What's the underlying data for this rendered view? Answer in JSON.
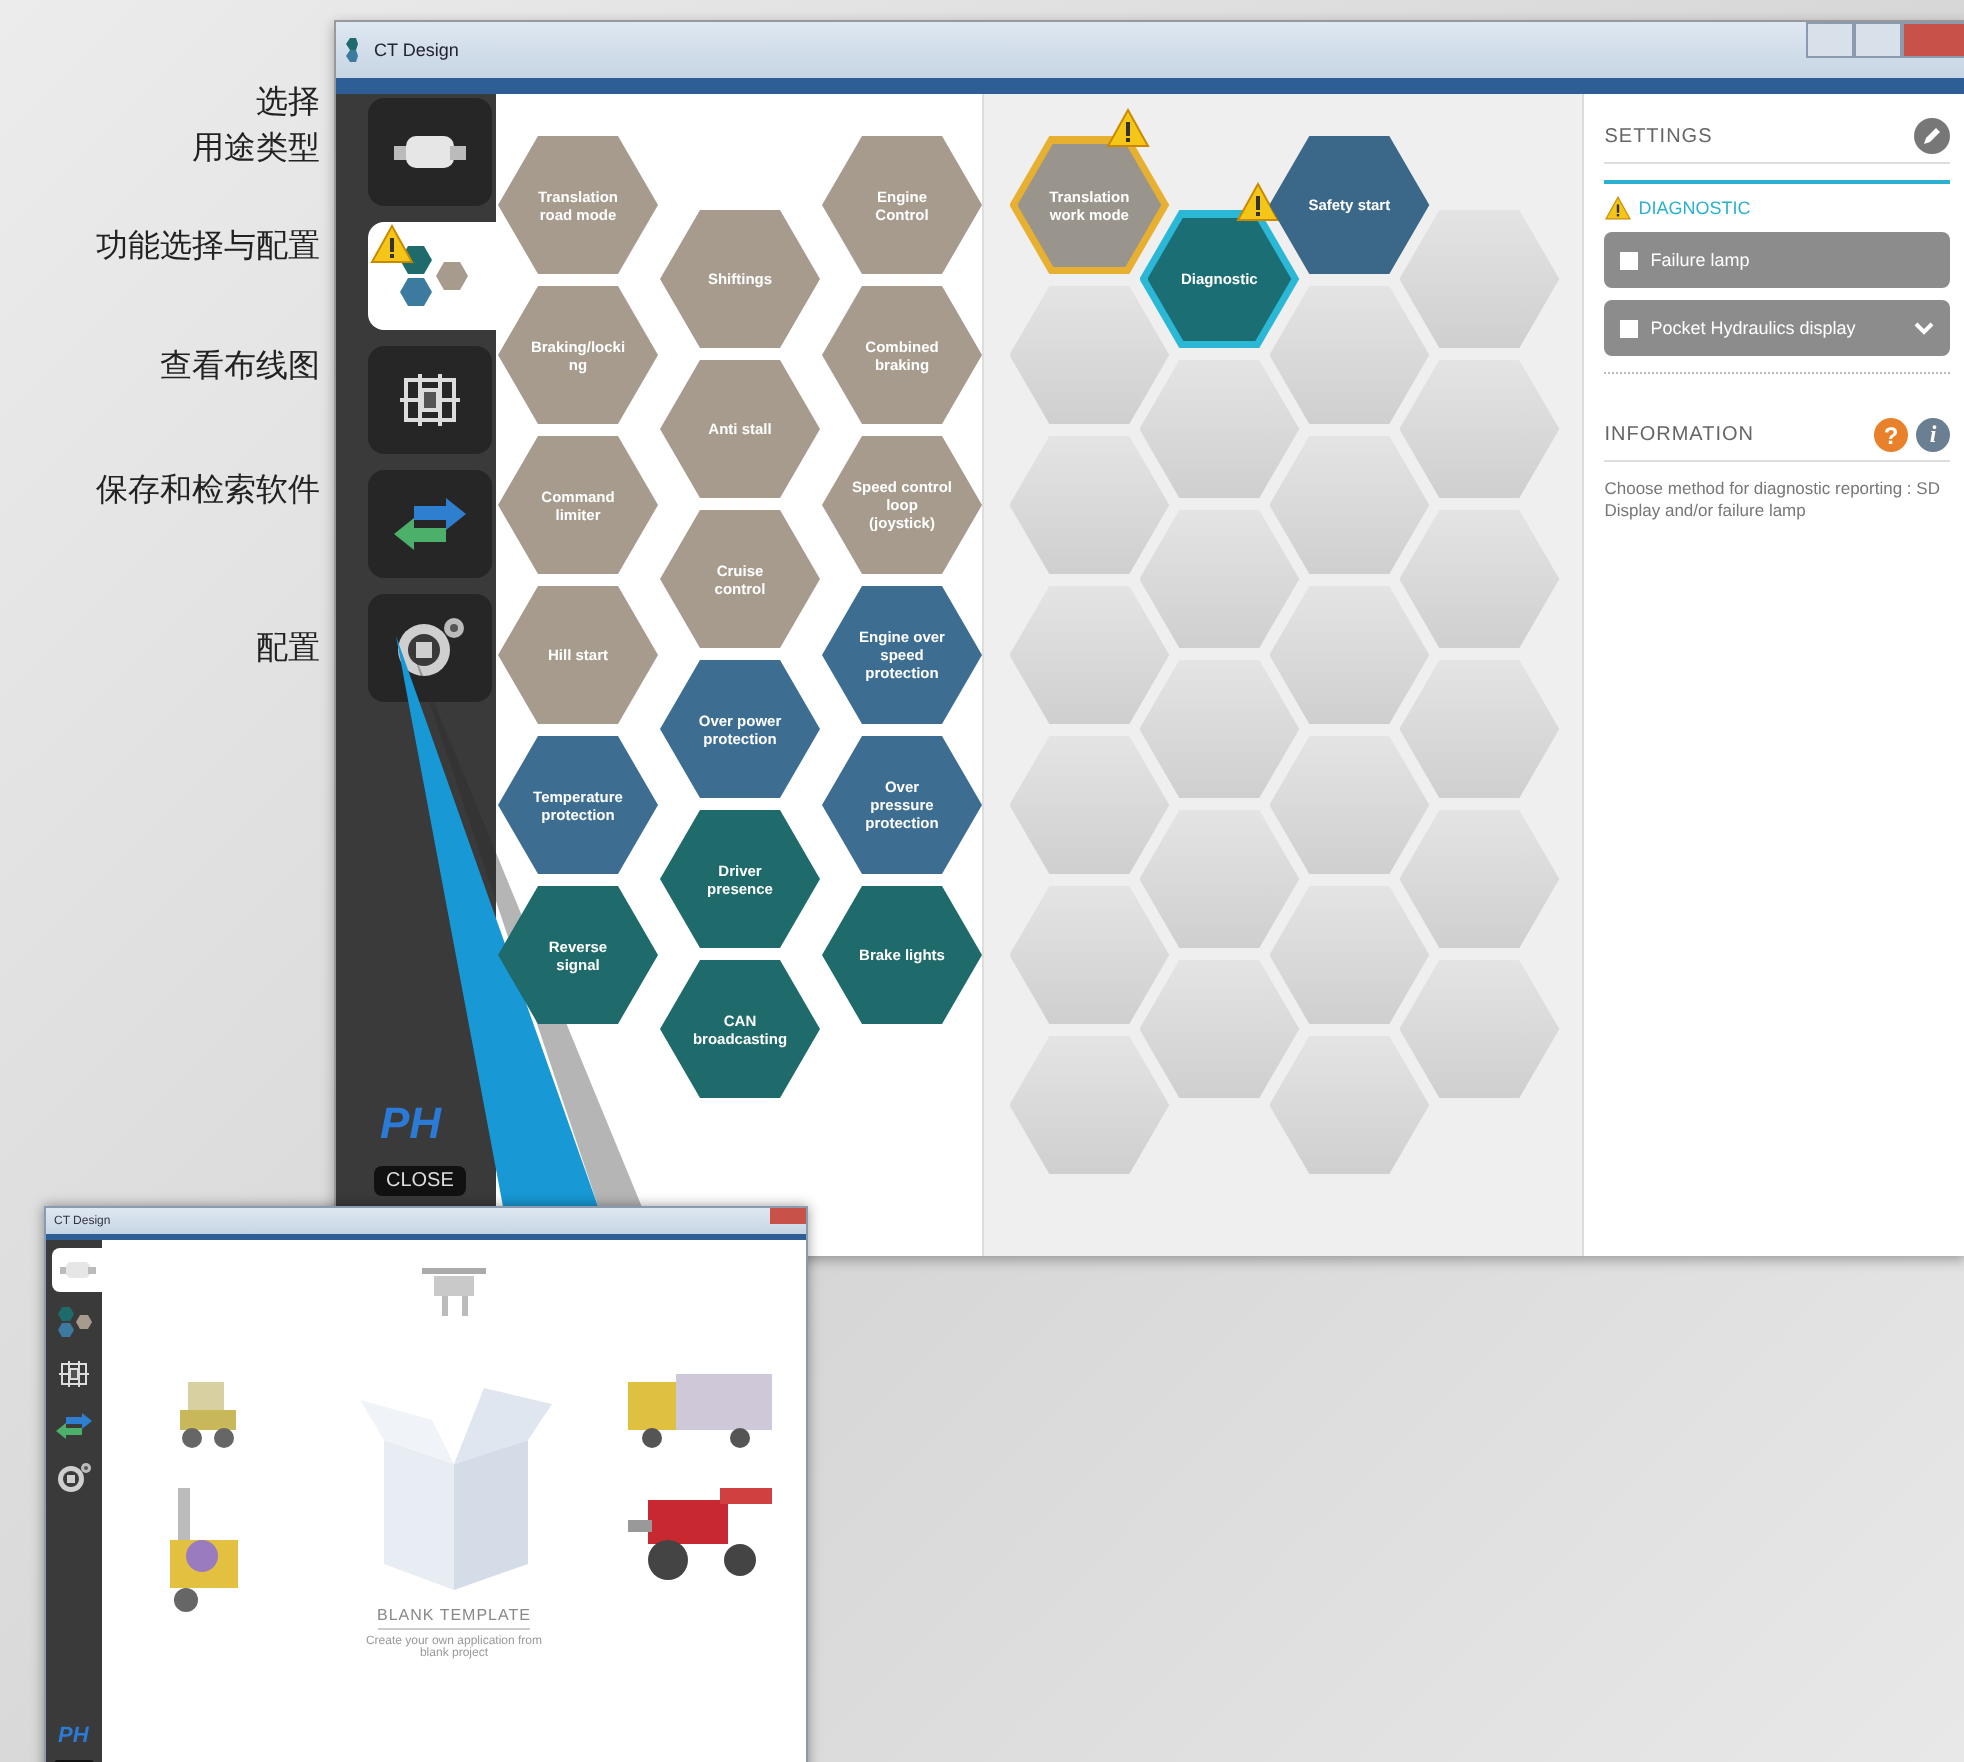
{
  "annotations": [
    {
      "text": "选择"
    },
    {
      "text": "用途类型"
    },
    {
      "text": "功能选择与配置"
    },
    {
      "text": "查看布线图"
    },
    {
      "text": "保存和检索软件"
    },
    {
      "text": "配置"
    }
  ],
  "main_window": {
    "title": "CT Design",
    "sidebar": {
      "items": [
        {
          "kind": "vehicle",
          "selected": false,
          "warning": false
        },
        {
          "kind": "functions",
          "selected": true,
          "warning": true
        },
        {
          "kind": "wiring",
          "selected": false,
          "warning": false
        },
        {
          "kind": "transfer",
          "selected": false,
          "warning": false
        },
        {
          "kind": "config",
          "selected": false,
          "warning": false
        }
      ],
      "logo": "PH",
      "close_button": "CLOSE"
    },
    "palette": [
      {
        "label": "Translation road mode",
        "color": "#a69b8d"
      },
      {
        "label": "Engine Control",
        "color": "#a69b8d"
      },
      {
        "label": "Shiftings",
        "color": "#a69b8d"
      },
      {
        "label": "Braking/locking",
        "color": "#a69b8d"
      },
      {
        "label": "Combined braking",
        "color": "#a69b8d"
      },
      {
        "label": "Anti stall",
        "color": "#a69b8d"
      },
      {
        "label": "Command limiter",
        "color": "#a69b8d"
      },
      {
        "label": "Speed control loop (joystick)",
        "color": "#a69b8d"
      },
      {
        "label": "Cruise control",
        "color": "#a69b8d"
      },
      {
        "label": "Hill start",
        "color": "#a69b8d"
      },
      {
        "label": "Engine over speed protection",
        "color": "#3d6e92"
      },
      {
        "label": "Over power protection",
        "color": "#3d6e92"
      },
      {
        "label": "Temperature protection",
        "color": "#3d6e92"
      },
      {
        "label": "Over pressure protection",
        "color": "#3d6e92"
      },
      {
        "label": "Driver presence",
        "color": "#1f6a6a"
      },
      {
        "label": "Reverse signal",
        "color": "#1f6a6a"
      },
      {
        "label": "Brake lights",
        "color": "#1f6a6a"
      },
      {
        "label": "CAN broadcasting",
        "color": "#1f6a6a"
      }
    ],
    "layout_grid": {
      "placed": [
        {
          "label": "Translation work mode",
          "color": "#9a958c",
          "warning": true,
          "selected": false
        },
        {
          "label": "Diagnostic",
          "color": "#1a6e74",
          "warning": true,
          "selected": true
        },
        {
          "label": "Safety start",
          "color": "#3b6788",
          "warning": false,
          "selected": false
        }
      ]
    },
    "settings": {
      "title": "SETTINGS",
      "section": {
        "title": "DIAGNOSTIC",
        "warning": true,
        "options": [
          {
            "kind": "checkbox",
            "label": "Failure lamp",
            "checked": false
          },
          {
            "kind": "dropdown",
            "label": "Pocket Hydraulics display",
            "checked": false
          }
        ]
      }
    },
    "information": {
      "title": "INFORMATION",
      "help_icon": "?",
      "info_icon": "i",
      "text": "Choose method for diagnostic reporting : SD Display and/or failure lamp"
    }
  },
  "inset_window": {
    "title": "CT Design",
    "sidebar_items": [
      {
        "kind": "vehicle",
        "selected": true
      },
      {
        "kind": "functions",
        "selected": false
      },
      {
        "kind": "wiring",
        "selected": false
      },
      {
        "kind": "transfer",
        "selected": false
      },
      {
        "kind": "config",
        "selected": false
      }
    ],
    "logo": "PH",
    "template": {
      "title": "BLANK TEMPLATE",
      "subtitle": "Create your own application from blank project"
    }
  }
}
